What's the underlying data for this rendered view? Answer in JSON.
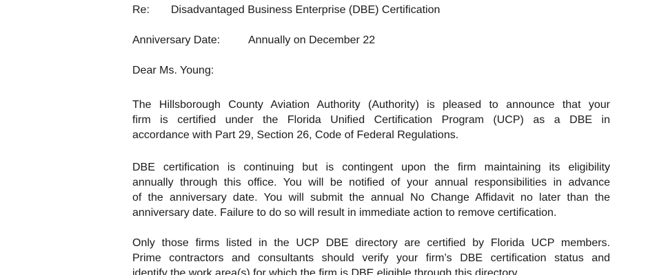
{
  "re": {
    "label": "Re:",
    "subject": "Disadvantaged Business Enterprise (DBE) Certification"
  },
  "anniversary": {
    "label": "Anniversary Date:",
    "value": "Annually on December 22"
  },
  "salutation": "Dear Ms. Young:",
  "paragraphs": [
    {
      "lines": [
        "The Hillsborough County Aviation Authority (Authority) is pleased to announce that your",
        "firm is certified under the Florida Unified Certification Program (UCP) as a DBE in",
        "accordance with Part 29, Section 26, Code of Federal Regulations."
      ]
    },
    {
      "lines": [
        "DBE certification is continuing but is contingent upon the firm maintaining its eligibility",
        "annually through this office. You will be notified of your annual responsibilities in advance",
        "of the anniversary date. You will submit the annual No Change Affidavit no later than the",
        "anniversary date. Failure to do so will result in immediate action to remove certification."
      ]
    },
    {
      "lines": [
        "Only those firms listed in the UCP DBE directory are certified by Florida UCP members.",
        "Prime contractors and consultants should verify your firm’s DBE certification status and",
        "identify the work area(s) for which the firm is DBE eligible through this directory."
      ]
    }
  ]
}
